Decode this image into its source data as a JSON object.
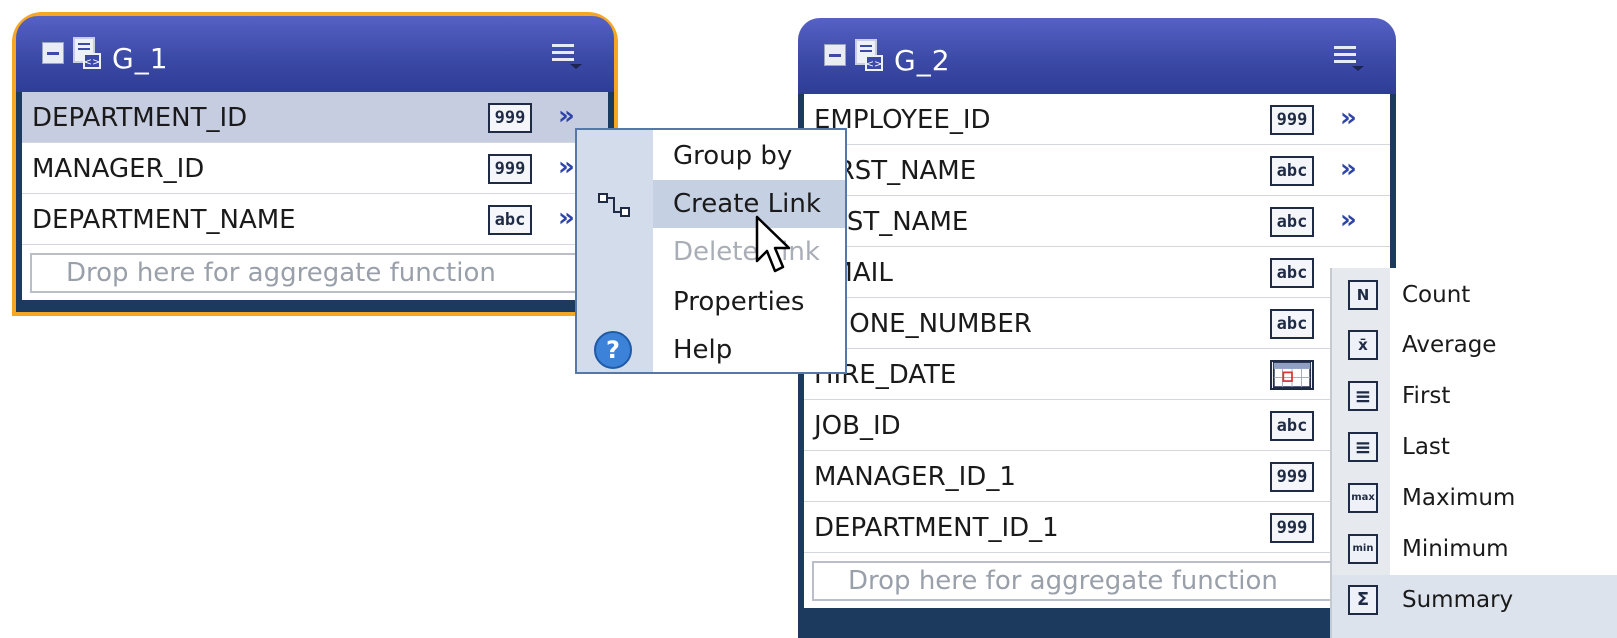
{
  "groups": [
    {
      "title": "G_1",
      "selected": true,
      "rows": [
        {
          "name": "DEPARTMENT_ID",
          "type": "999",
          "highlight": true
        },
        {
          "name": "MANAGER_ID",
          "type": "999"
        },
        {
          "name": "DEPARTMENT_NAME",
          "type": "abc"
        }
      ],
      "drop_placeholder": "Drop here for aggregate function"
    },
    {
      "title": "G_2",
      "selected": false,
      "rows": [
        {
          "name": "EMPLOYEE_ID",
          "type": "999"
        },
        {
          "name": "FIRST_NAME",
          "type": "abc"
        },
        {
          "name": "LAST_NAME",
          "type": "abc"
        },
        {
          "name": "EMAIL",
          "type": "abc"
        },
        {
          "name": "PHONE_NUMBER",
          "type": "abc"
        },
        {
          "name": "HIRE_DATE",
          "type": "date"
        },
        {
          "name": "JOB_ID",
          "type": "abc"
        },
        {
          "name": "MANAGER_ID_1",
          "type": "999"
        },
        {
          "name": "DEPARTMENT_ID_1",
          "type": "999"
        }
      ],
      "drop_placeholder": "Drop here for aggregate function"
    }
  ],
  "context_menu": {
    "items": [
      {
        "label": "Group by",
        "icon": ""
      },
      {
        "label": "Create Link",
        "icon": "link-icon",
        "hover": true
      },
      {
        "label": "Delete Link",
        "icon": "",
        "disabled": true
      },
      {
        "label": "Properties",
        "icon": ""
      },
      {
        "label": "Help",
        "icon": "help-icon"
      }
    ]
  },
  "aggregate_menu": {
    "items": [
      {
        "label": "Count",
        "icon_text": "N"
      },
      {
        "label": "Average",
        "icon_text": "x̄"
      },
      {
        "label": "First",
        "icon_text": "≡"
      },
      {
        "label": "Last",
        "icon_text": "≡"
      },
      {
        "label": "Maximum",
        "icon_text": "max"
      },
      {
        "label": "Minimum",
        "icon_text": "min"
      },
      {
        "label": "Summary",
        "icon_text": "Σ",
        "hover": true
      }
    ]
  },
  "colors": {
    "header": "#3c4aa7",
    "selection_outline": "#f5a623",
    "row_highlight": "#c6cde0",
    "chevron": "#2e44a8"
  }
}
